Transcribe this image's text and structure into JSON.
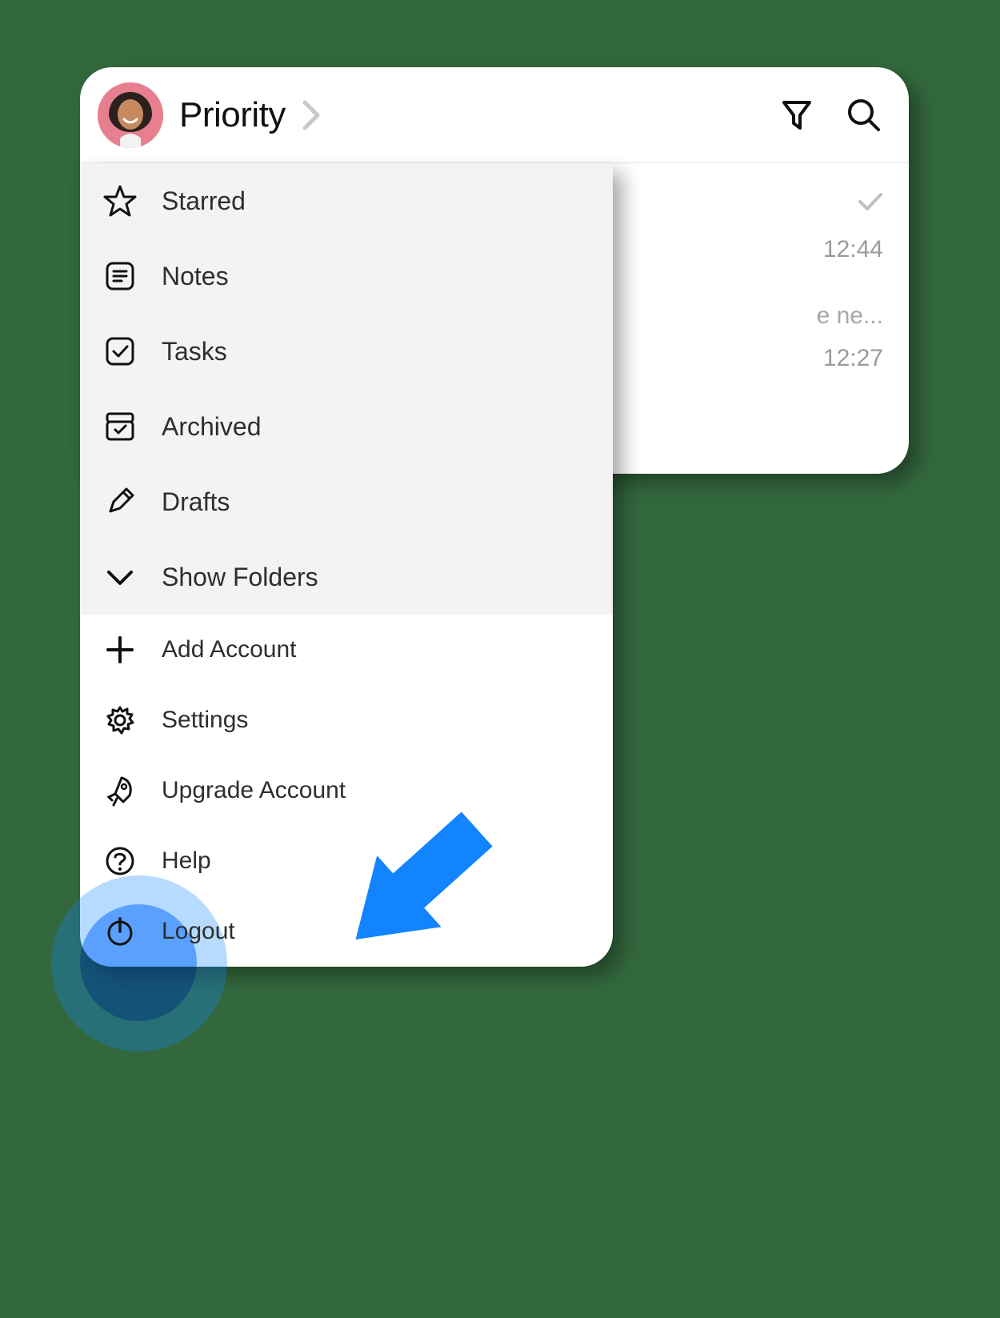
{
  "header": {
    "title": "Priority",
    "avatar_name": "user-avatar"
  },
  "background_list": {
    "row1_time": "12:44",
    "row2_snippet": "e ne...",
    "row2_time": "12:27"
  },
  "menu": {
    "top": [
      {
        "icon": "star-icon",
        "label": "Starred"
      },
      {
        "icon": "note-icon",
        "label": "Notes"
      },
      {
        "icon": "task-icon",
        "label": "Tasks"
      },
      {
        "icon": "archive-icon",
        "label": "Archived"
      },
      {
        "icon": "pencil-icon",
        "label": "Drafts"
      },
      {
        "icon": "chevron-down-icon",
        "label": "Show Folders"
      }
    ],
    "bottom": [
      {
        "icon": "plus-icon",
        "label": "Add Account"
      },
      {
        "icon": "gear-icon",
        "label": "Settings"
      },
      {
        "icon": "rocket-icon",
        "label": "Upgrade Account"
      },
      {
        "icon": "help-icon",
        "label": "Help"
      },
      {
        "icon": "power-icon",
        "label": "Logout"
      }
    ]
  },
  "annotation": {
    "highlight_target": "logout-menu-item",
    "arrow_color": "#1284ff"
  }
}
